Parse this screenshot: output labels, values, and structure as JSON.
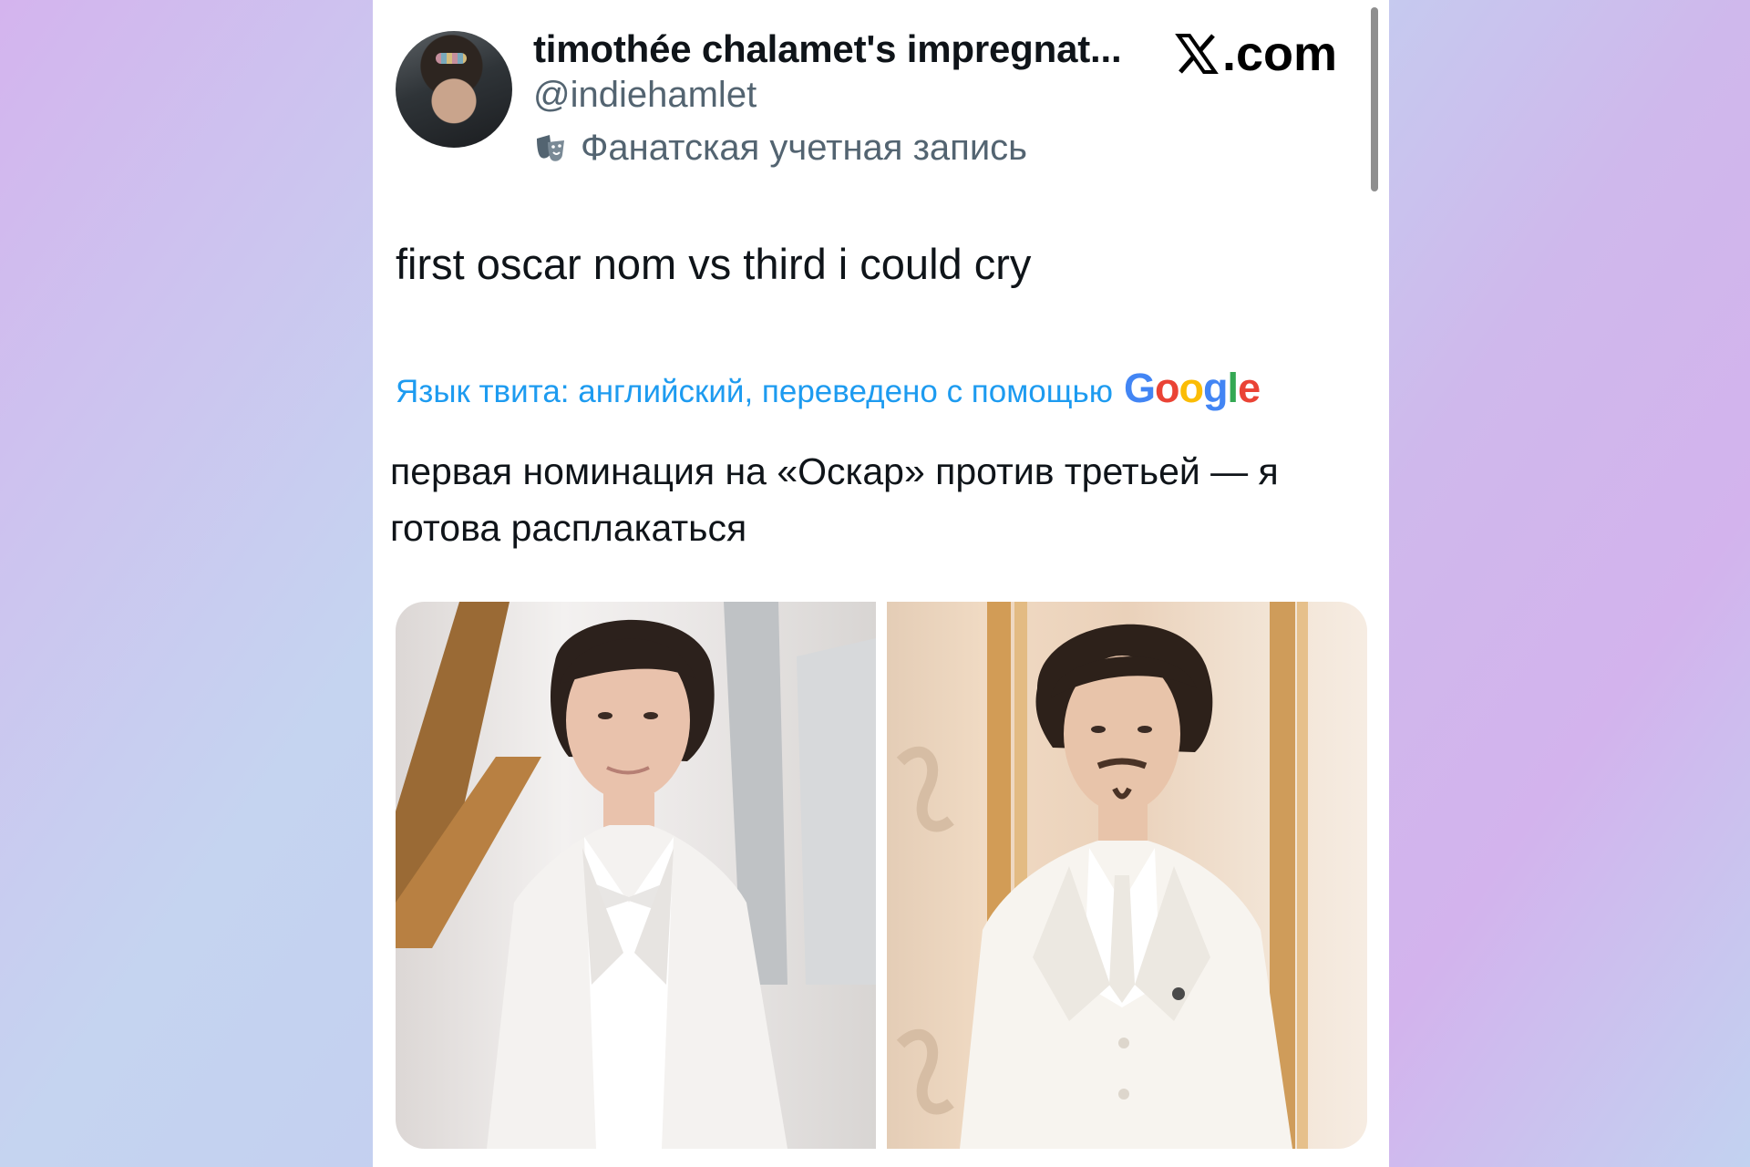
{
  "post": {
    "display_name": "timothée chalamet's impregnat...",
    "handle": "@indiehamlet",
    "fan_badge_icon": "theater-masks-icon",
    "fan_label": "Фанатская учетная запись",
    "source_logo_text": ".com",
    "text": "first oscar nom vs third i could cry",
    "translation_notice": "Язык твита: английский, переведено с помощью",
    "translation_brand": "Google",
    "translation": "первая номинация на «Оскар» против третьей — я готова расплакаться"
  },
  "media": {
    "count": 2
  },
  "colors": {
    "link_blue": "#1d9bf0",
    "secondary_text": "#536471",
    "primary_text": "#0f1419"
  }
}
